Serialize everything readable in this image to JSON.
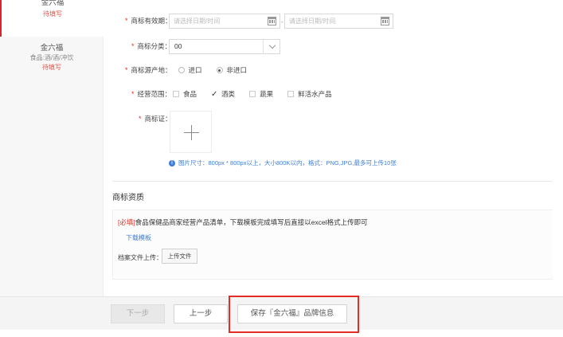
{
  "sidebar": {
    "items": [
      {
        "name": "金六福",
        "sub": "",
        "status": "待填写"
      },
      {
        "name": "金六福",
        "sub": "食品:酒/酒/冲饮",
        "status": "待填写"
      }
    ]
  },
  "form": {
    "validity": {
      "label": "商标有效期：",
      "start_placeholder": "请选择日期/时间",
      "end_placeholder": "请选择日期/时间",
      "sep": "-"
    },
    "category": {
      "label": "商标分类：",
      "value": "00"
    },
    "origin": {
      "label": "商标源产地：",
      "options": [
        "进口",
        "非进口"
      ],
      "selected": "非进口"
    },
    "scope": {
      "label": "经营范围：",
      "options": [
        "食品",
        "酒类",
        "蔬果",
        "鲜活水产品"
      ],
      "checked": [
        "酒类"
      ]
    },
    "certificate": {
      "label": "商标证："
    },
    "hint": "图片尺寸：800px * 800px以上，大小800K以内，格式：PNG,JPG,最多可上传10张"
  },
  "qualification": {
    "title": "商标资质",
    "must_tag": "[必填]",
    "desc": "食品保健品商家经营产品清单，下载模板完成填写后直接以excel格式上传即可",
    "template_link": "下载模板",
    "file_label": "档案文件上传：",
    "upload_button": "上传文件"
  },
  "footer": {
    "next": "下一步",
    "prev": "上一步",
    "save": "保存『金六福』品牌信息"
  },
  "colors": {
    "required": "#e02e24",
    "link": "#3f7ed6",
    "highlight": "#e02e24"
  }
}
